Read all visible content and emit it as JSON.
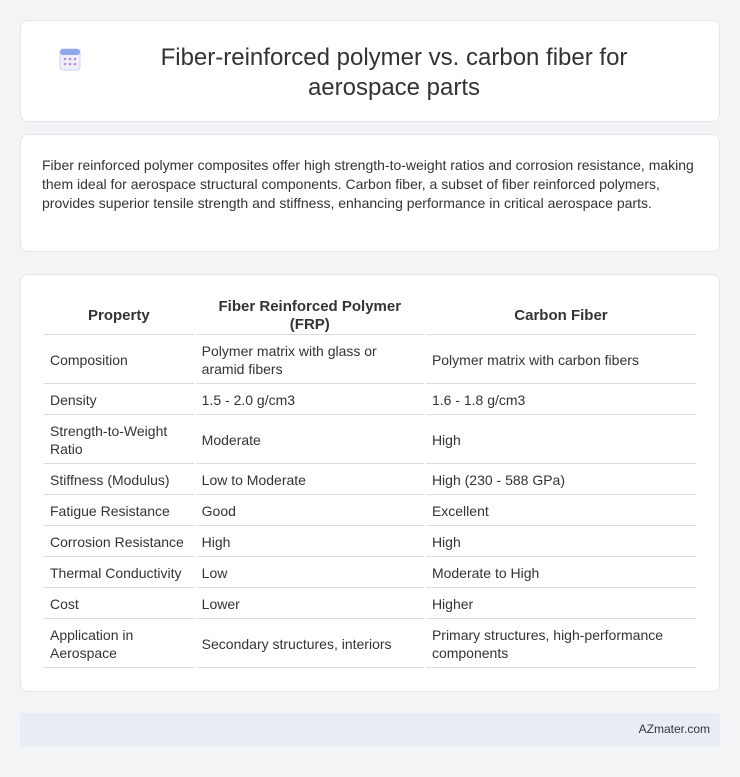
{
  "header": {
    "title": "Fiber-reinforced polymer vs. carbon fiber for aerospace parts",
    "icon": "calendar-icon"
  },
  "intro": {
    "text": "Fiber reinforced polymer composites offer high strength-to-weight ratios and corrosion resistance, making them ideal for aerospace structural components. Carbon fiber, a subset of fiber reinforced polymers, provides superior tensile strength and stiffness, enhancing performance in critical aerospace parts."
  },
  "table": {
    "headers": [
      "Property",
      "Fiber Reinforced Polymer (FRP)",
      "Carbon Fiber"
    ],
    "rows": [
      [
        "Composition",
        "Polymer matrix with glass or aramid fibers",
        "Polymer matrix with carbon fibers"
      ],
      [
        "Density",
        "1.5 - 2.0 g/cm3",
        "1.6 - 1.8 g/cm3"
      ],
      [
        "Strength-to-Weight Ratio",
        "Moderate",
        "High"
      ],
      [
        "Stiffness (Modulus)",
        "Low to Moderate",
        "High (230 - 588 GPa)"
      ],
      [
        "Fatigue Resistance",
        "Good",
        "Excellent"
      ],
      [
        "Corrosion Resistance",
        "High",
        "High"
      ],
      [
        "Thermal Conductivity",
        "Low",
        "Moderate to High"
      ],
      [
        "Cost",
        "Lower",
        "Higher"
      ],
      [
        "Application in Aerospace",
        "Secondary structures, interiors",
        "Primary structures, high-performance components"
      ]
    ]
  },
  "footer": {
    "text": "AZmater.com"
  },
  "colors": {
    "background": "#f3f4f6",
    "card": "#ffffff",
    "footer": "#e8edf5",
    "icon_accent": "#8fa8e8",
    "icon_dots": "#b58ad8"
  }
}
